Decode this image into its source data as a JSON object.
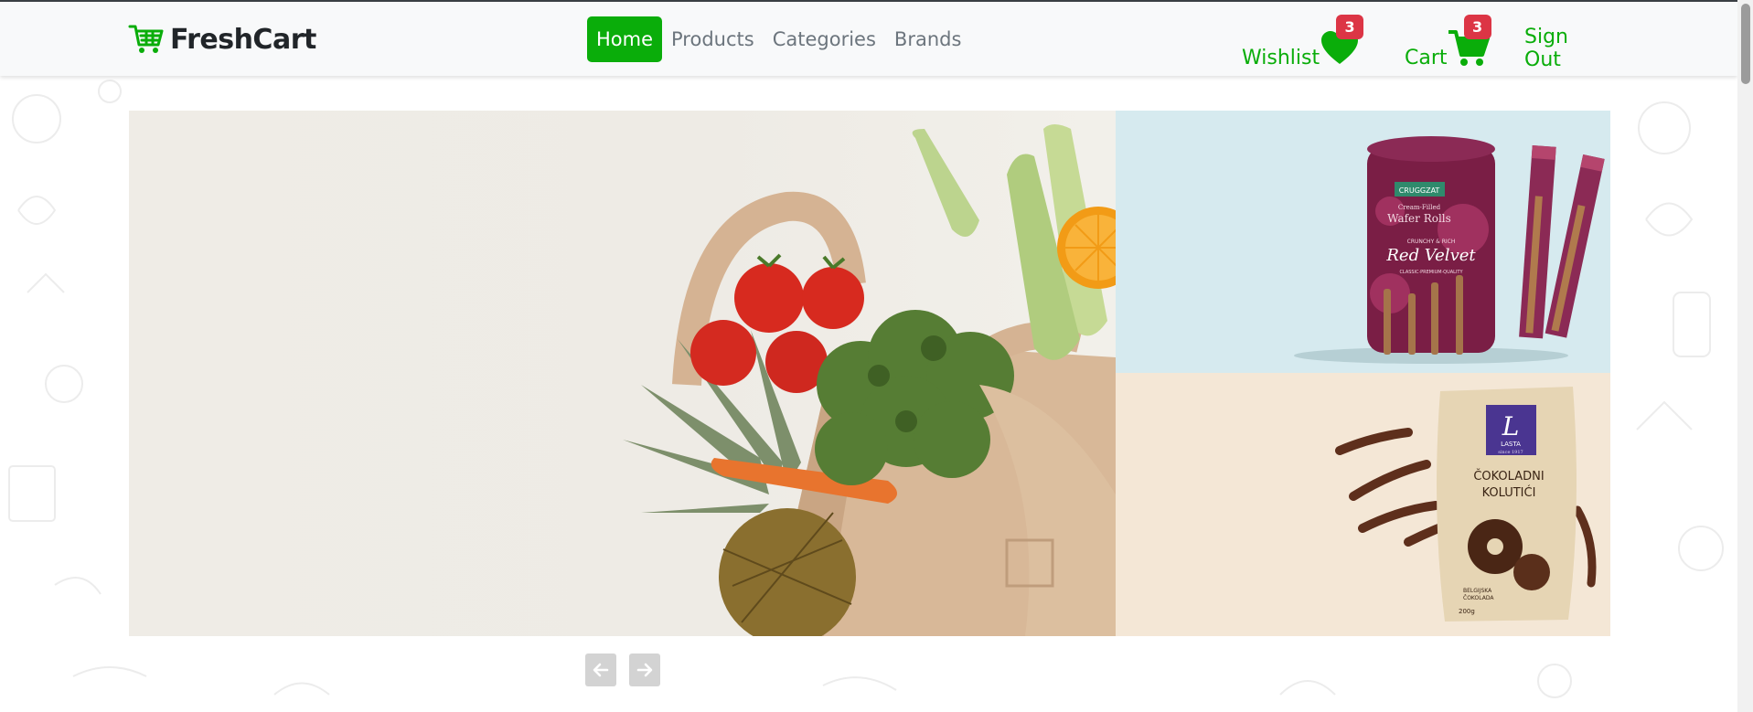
{
  "brand": {
    "name": "FreshCart",
    "icon": "shopping-cart-icon",
    "color": "#0aad0a"
  },
  "nav": {
    "links": [
      {
        "label": "Home",
        "active": true
      },
      {
        "label": "Products",
        "active": false
      },
      {
        "label": "Categories",
        "active": false
      },
      {
        "label": "Brands",
        "active": false
      }
    ]
  },
  "actions": {
    "wishlist": {
      "label": "Wishlist",
      "count": "3",
      "icon": "heart-icon"
    },
    "cart": {
      "label": "Cart",
      "count": "3",
      "icon": "cart-icon"
    },
    "signout": {
      "label": "Sign Out"
    }
  },
  "banner": {
    "main_image": "grocery-bag-with-vegetables",
    "side_top_image": "red-velvet-wafer-rolls",
    "side_bottom_image": "lasta-cokoladni-kolutici",
    "wafer": {
      "brand": "CRUGGZAT",
      "line1": "Cream-Filled",
      "line2": "Wafer Rolls",
      "tag": "CRUNCHY & RICH",
      "flavor": "Red Velvet",
      "sub": "CLASSIC·PREMIUM·QUALITY"
    },
    "lasta": {
      "logo": "L",
      "brand": "LASTA",
      "since": "since 1917",
      "name1": "ČOKOLADNI",
      "name2": "KOLUTIĆI",
      "sub1": "BELGIJSKA",
      "sub2": "ČOKOLADA",
      "weight": "200g"
    }
  },
  "slider": {
    "prev_icon": "arrow-left-icon",
    "next_icon": "arrow-right-icon"
  },
  "colors": {
    "accent": "#0aad0a",
    "badge": "#dc3545",
    "text_muted": "#6c757d"
  }
}
